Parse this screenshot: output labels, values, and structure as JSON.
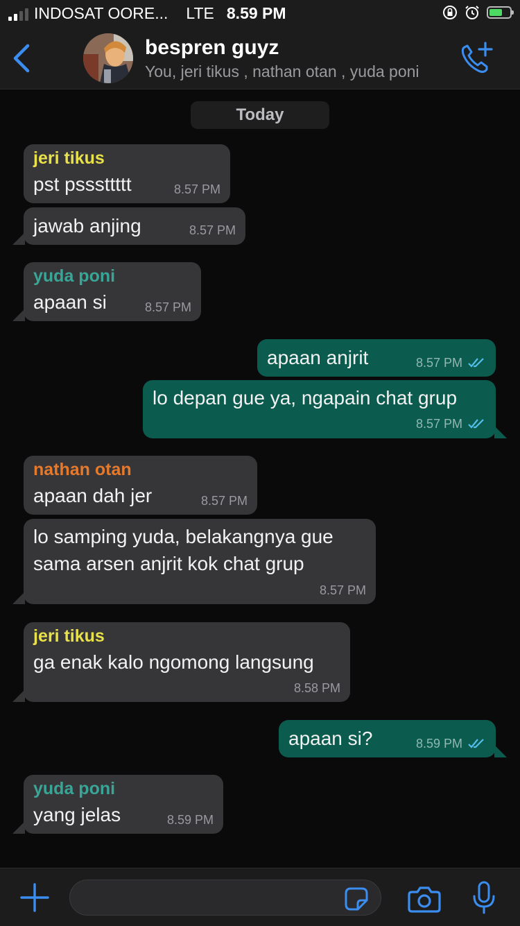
{
  "status_bar": {
    "carrier": "INDOSAT OORE...",
    "network": "LTE",
    "time": "8.59 PM",
    "signal_bars_filled": 2,
    "battery_level": 0.65,
    "battery_color": "#4cd964"
  },
  "header": {
    "title": "bespren guyz",
    "subtitle": "You, jeri tikus , nathan otan , yuda poni",
    "accent_color": "#3b8ef0",
    "icons": [
      "chevron-left-icon",
      "group-avatar",
      "add-call-icon"
    ]
  },
  "chat": {
    "date_label": "Today",
    "messages": [
      {
        "direction": "incoming",
        "sender": "jeri tikus",
        "sender_color": "#e8e14a",
        "text": "pst psssttttt",
        "time": "8.57 PM"
      },
      {
        "direction": "incoming",
        "text": "jawab anjing",
        "time": "8.57 PM"
      },
      {
        "direction": "incoming",
        "sender": "yuda poni",
        "sender_color": "#3aa597",
        "text": "apaan si",
        "time": "8.57 PM"
      },
      {
        "direction": "outgoing",
        "text": "apaan anjrit",
        "time": "8.57 PM",
        "status": "read"
      },
      {
        "direction": "outgoing",
        "text": "lo depan gue ya, ngapain chat grup",
        "time": "8.57 PM",
        "status": "read"
      },
      {
        "direction": "incoming",
        "sender": "nathan otan",
        "sender_color": "#e5792c",
        "text": "apaan dah jer",
        "time": "8.57 PM"
      },
      {
        "direction": "incoming",
        "lines": [
          "lo samping yuda, belakangnya gue",
          "sama arsen anjrit kok chat grup"
        ],
        "time": "8.57 PM"
      },
      {
        "direction": "incoming",
        "sender": "jeri tikus",
        "sender_color": "#e8e14a",
        "text": "ga enak kalo ngomong langsung",
        "time": "8.58 PM"
      },
      {
        "direction": "outgoing",
        "text": "apaan si?",
        "time": "8.59 PM",
        "status": "read"
      },
      {
        "direction": "incoming",
        "sender": "yuda poni",
        "sender_color": "#3aa597",
        "text": "yang jelas",
        "time": "8.59 PM"
      }
    ]
  },
  "composer": {
    "value": "",
    "icons": [
      "plus-icon",
      "sticker-icon",
      "camera-icon",
      "microphone-icon"
    ]
  },
  "colors": {
    "incoming_bubble": "#363638",
    "outgoing_bubble": "#0b5c4e",
    "read_ticks": "#53bdeb"
  }
}
